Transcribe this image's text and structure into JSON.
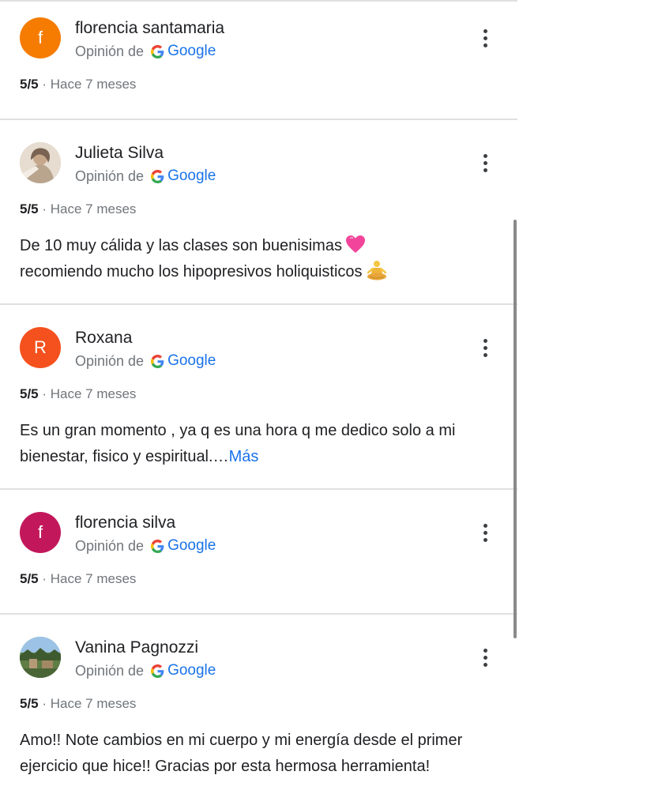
{
  "source_label": "Opinión de",
  "google_label": "Google",
  "reviews": [
    {
      "name": "florencia santamaria",
      "initial": "f",
      "avatar_color": "#f57c00",
      "avatar_type": "initial",
      "score": "5/5",
      "time": "· Hace 7 meses",
      "text": "",
      "more": ""
    },
    {
      "name": "Julieta Silva",
      "initial": "",
      "avatar_color": "#c9b8a6",
      "avatar_type": "photo-portrait",
      "score": "5/5",
      "time": "· Hace 7 meses",
      "text_line1": "De 10 muy cálida y las clases son buenisimas",
      "text_line2": "recomiendo mucho los hipopresivos holiquisticos",
      "more": ""
    },
    {
      "name": "Roxana",
      "initial": "R",
      "avatar_color": "#f4511e",
      "avatar_type": "initial",
      "score": "5/5",
      "time": "· Hace 7 meses",
      "text": "Es un gran momento , ya q es una hora q me dedico solo a mi bienestar, fisico y espiritual.…",
      "more": "Más"
    },
    {
      "name": "florencia silva",
      "initial": "f",
      "avatar_color": "#c2185b",
      "avatar_type": "initial",
      "score": "5/5",
      "time": "· Hace 7 meses",
      "text": "",
      "more": ""
    },
    {
      "name": "Vanina Pagnozzi",
      "initial": "",
      "avatar_color": "#6d8a5a",
      "avatar_type": "photo-landscape",
      "score": "5/5",
      "time": "· Hace 7 meses",
      "text": "Amo!! Note cambios en mi cuerpo y mi energía desde el primer ejercicio que hice!! Gracias por esta hermosa herramienta!",
      "more": ""
    }
  ],
  "colors": {
    "google_blue": "#1a73e8",
    "secondary_text": "#70757a",
    "primary_text": "#202124"
  },
  "icons": {
    "google": "google-g-icon",
    "menu": "more-vert-icon",
    "heart": "pink-heart-emoji",
    "yoga": "person-in-lotus-position-emoji"
  }
}
